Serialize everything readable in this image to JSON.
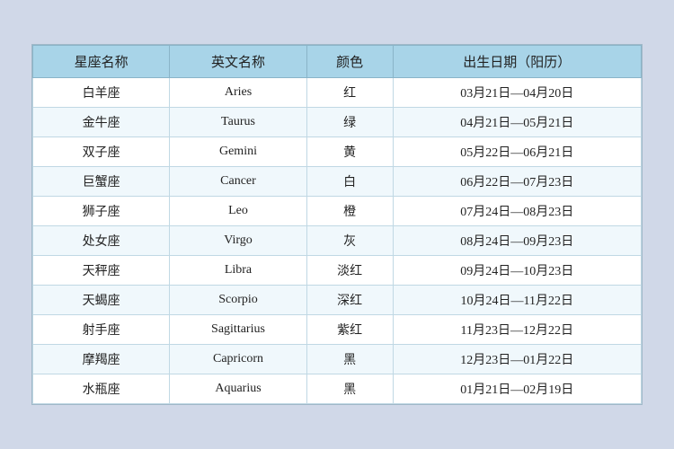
{
  "table": {
    "headers": [
      "星座名称",
      "英文名称",
      "颜色",
      "出生日期（阳历）"
    ],
    "rows": [
      {
        "chinese": "白羊座",
        "english": "Aries",
        "color": "红",
        "dates": "03月21日—04月20日"
      },
      {
        "chinese": "金牛座",
        "english": "Taurus",
        "color": "绿",
        "dates": "04月21日—05月21日"
      },
      {
        "chinese": "双子座",
        "english": "Gemini",
        "color": "黄",
        "dates": "05月22日—06月21日"
      },
      {
        "chinese": "巨蟹座",
        "english": "Cancer",
        "color": "白",
        "dates": "06月22日—07月23日"
      },
      {
        "chinese": "狮子座",
        "english": "Leo",
        "color": "橙",
        "dates": "07月24日—08月23日"
      },
      {
        "chinese": "处女座",
        "english": "Virgo",
        "color": "灰",
        "dates": "08月24日—09月23日"
      },
      {
        "chinese": "天秤座",
        "english": "Libra",
        "color": "淡红",
        "dates": "09月24日—10月23日"
      },
      {
        "chinese": "天蝎座",
        "english": "Scorpio",
        "color": "深红",
        "dates": "10月24日—11月22日"
      },
      {
        "chinese": "射手座",
        "english": "Sagittarius",
        "color": "紫红",
        "dates": "11月23日—12月22日"
      },
      {
        "chinese": "摩羯座",
        "english": "Capricorn",
        "color": "黑",
        "dates": "12月23日—01月22日"
      },
      {
        "chinese": "水瓶座",
        "english": "Aquarius",
        "color": "黑",
        "dates": "01月21日—02月19日"
      }
    ]
  }
}
